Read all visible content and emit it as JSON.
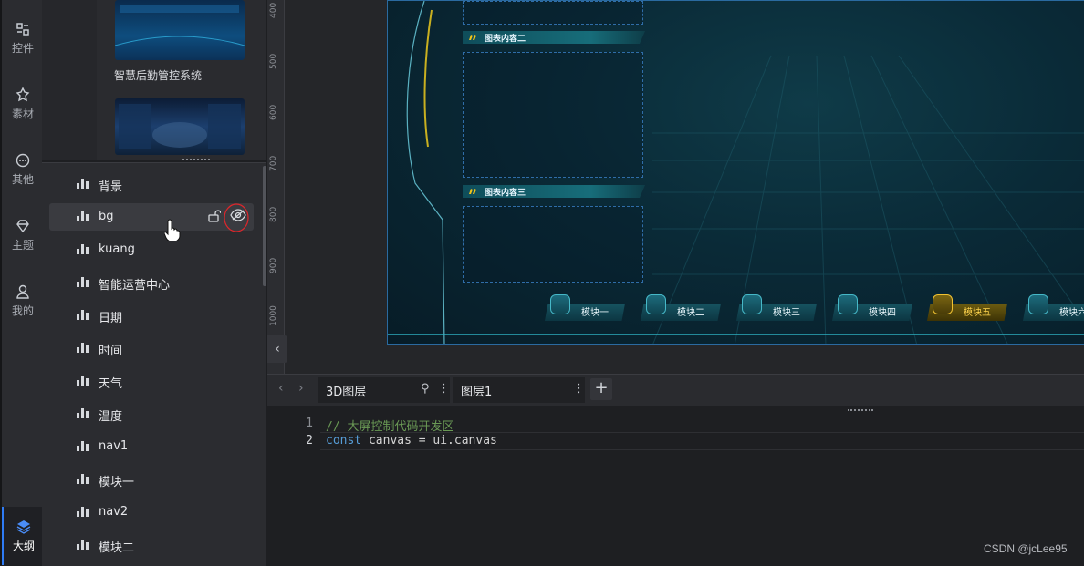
{
  "rail": {
    "items": [
      {
        "label": "控件",
        "icon": "widgets-icon"
      },
      {
        "label": "素材",
        "icon": "assets-icon"
      },
      {
        "label": "其他",
        "icon": "more-icon"
      },
      {
        "label": "主题",
        "icon": "theme-icon"
      },
      {
        "label": "我的",
        "icon": "user-icon"
      }
    ],
    "active": {
      "label": "大纲",
      "icon": "layers-icon"
    }
  },
  "assets": {
    "template_title": "智慧后勤管控系统"
  },
  "outline": {
    "layers": [
      {
        "label": "背景"
      },
      {
        "label": "bg",
        "selected": true
      },
      {
        "label": "kuang"
      },
      {
        "label": "智能运营中心"
      },
      {
        "label": "日期"
      },
      {
        "label": "时间"
      },
      {
        "label": "天气"
      },
      {
        "label": "温度"
      },
      {
        "label": "nav1"
      },
      {
        "label": "模块一"
      },
      {
        "label": "nav2"
      },
      {
        "label": "模块二"
      }
    ]
  },
  "canvas": {
    "ruler_ticks": [
      "400",
      "500",
      "600",
      "700",
      "800",
      "900",
      "1000"
    ],
    "panels": [
      {
        "title": "图表内容二"
      },
      {
        "title": "图表内容三"
      }
    ],
    "nav": [
      {
        "label": "模块一",
        "active": false
      },
      {
        "label": "模块二",
        "active": false
      },
      {
        "label": "模块三",
        "active": false
      },
      {
        "label": "模块四",
        "active": false
      },
      {
        "label": "模块五",
        "active": true
      },
      {
        "label": "模块六",
        "active": false
      }
    ],
    "accent_color": "#3aa6b8",
    "active_color": "#ffd44d"
  },
  "tabs": [
    {
      "label": "3D图层"
    },
    {
      "label": "图层1"
    }
  ],
  "editor": {
    "lines": [
      {
        "num": "1",
        "comment": "// 大屏控制代码开发区"
      },
      {
        "num": "2",
        "keyword": "const",
        "rest": " canvas = ui.canvas"
      }
    ]
  },
  "watermark": "CSDN @jcLee95"
}
